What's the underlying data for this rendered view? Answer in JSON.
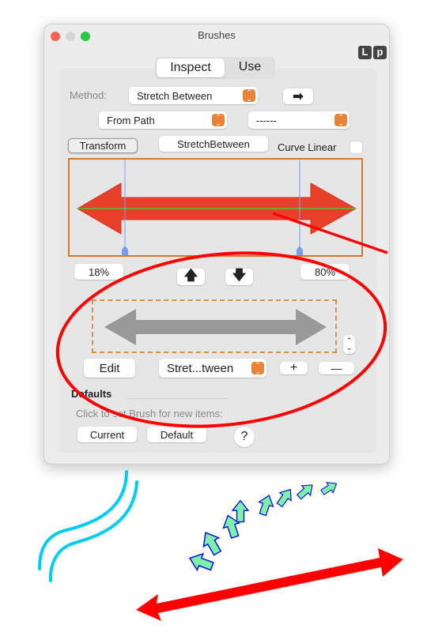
{
  "window": {
    "title": "Brushes",
    "badges": [
      "L",
      "p"
    ]
  },
  "tabs": [
    {
      "label": "Inspect",
      "selected": true
    },
    {
      "label": "Use",
      "selected": false
    }
  ],
  "method": {
    "label": "Method:",
    "value": "Stretch Between",
    "arrow_icon": "right-arrow-icon"
  },
  "source": {
    "value": "From Path",
    "secondary": "------"
  },
  "transform": {
    "button": "Transform",
    "name_field": "StretchBetween",
    "curve_linear_label": "Curve Linear",
    "curve_linear_checked": false
  },
  "preview": {
    "left_percent": "18%",
    "right_percent": "80%",
    "up_icon": "up-arrow-icon",
    "down_icon": "down-arrow-icon"
  },
  "brush": {
    "edit": "Edit",
    "selected": "Stret...tween",
    "add": "+",
    "remove": "—"
  },
  "defaults": {
    "heading": "Defaults",
    "hint": "Click to set Brush for new items:",
    "current": "Current",
    "default": "Default",
    "help": "?"
  },
  "colors": {
    "accent": "#e8843a",
    "annotation": "#ff0000",
    "preview_arrow": "#e8402a",
    "stroke": "#00ccf0",
    "small_arrows_fill": "#80f0a8",
    "small_arrows_stroke": "#0010e0"
  }
}
